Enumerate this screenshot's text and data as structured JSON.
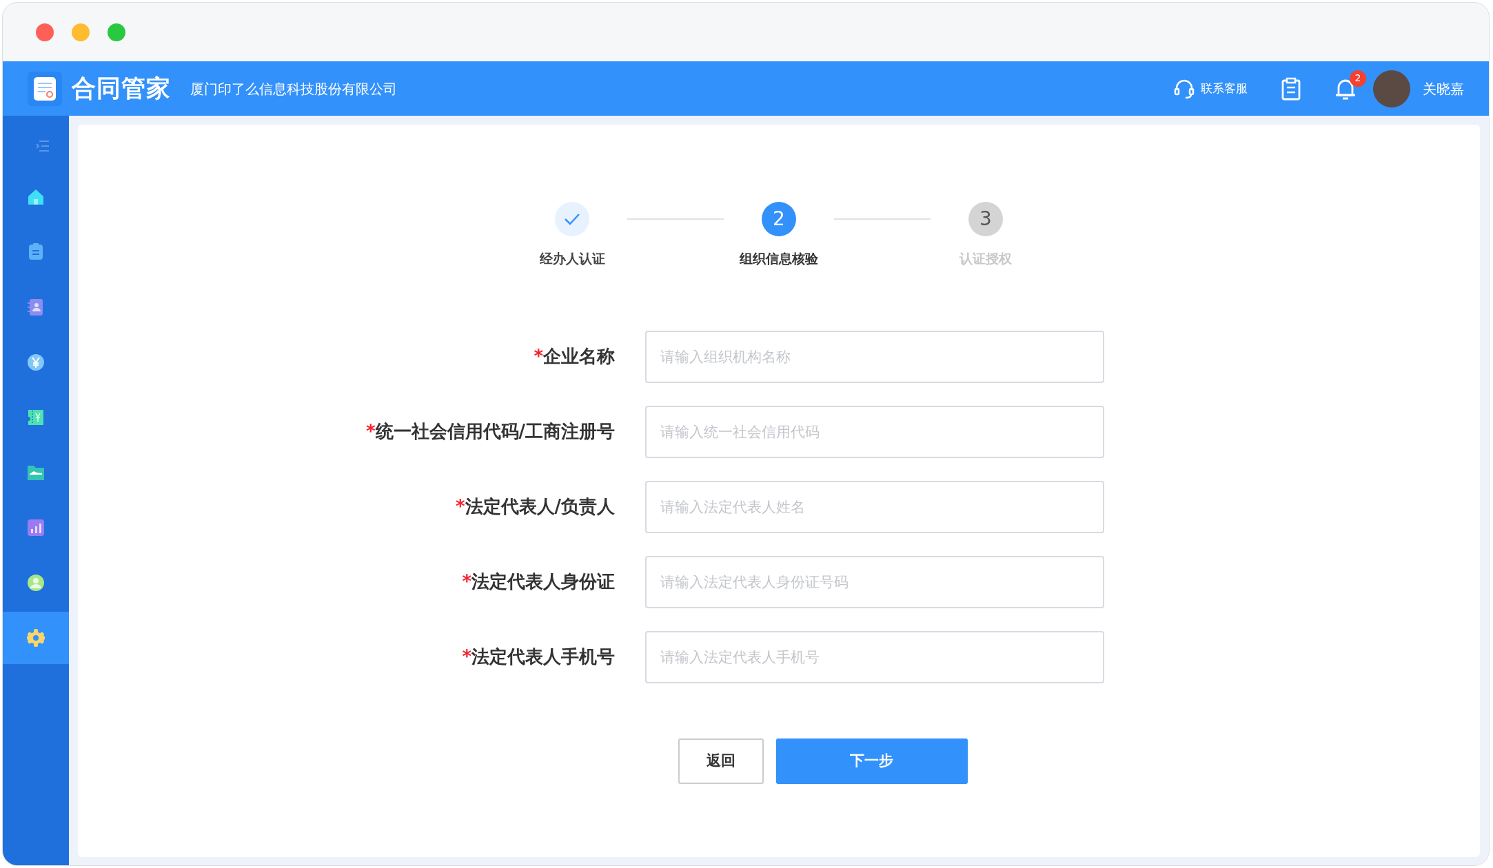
{
  "header": {
    "logo_text": "合同管家",
    "company": "厦门印了么信息科技股份有限公司",
    "support": "联系客服",
    "notification_count": "2",
    "user_name": "关晓嘉"
  },
  "sidebar": {
    "items": [
      {
        "kind": "home",
        "selected": false
      },
      {
        "kind": "document",
        "selected": false
      },
      {
        "kind": "contacts",
        "selected": false
      },
      {
        "kind": "yen",
        "selected": false
      },
      {
        "kind": "ticket",
        "selected": false
      },
      {
        "kind": "folder",
        "selected": false
      },
      {
        "kind": "chart",
        "selected": false
      },
      {
        "kind": "user",
        "selected": false
      },
      {
        "kind": "gear",
        "selected": true
      }
    ]
  },
  "steps": [
    {
      "label": "经办人认证",
      "completed": true,
      "selected": false
    },
    {
      "number": "2",
      "label": "组织信息核验",
      "completed": false,
      "selected": true
    },
    {
      "number": "3",
      "label": "认证授权",
      "completed": false,
      "selected": false
    }
  ],
  "form": {
    "fields": [
      {
        "mark": "*",
        "label": "企业名称",
        "placeholder": "请输入组织机构名称"
      },
      {
        "mark": "*",
        "label": "统一社会信用代码/工商注册号",
        "placeholder": "请输入统一社会信用代码"
      },
      {
        "mark": "*",
        "label": "法定代表人/负责人",
        "placeholder": "请输入法定代表人姓名"
      },
      {
        "mark": "*",
        "label": "法定代表人身份证",
        "placeholder": "请输入法定代表人身份证号码"
      },
      {
        "mark": "*",
        "label": "法定代表人手机号",
        "placeholder": "请输入法定代表人手机号"
      }
    ],
    "buttons": [
      {
        "label": "返回",
        "kind": "secondary"
      },
      {
        "label": "下一步",
        "kind": "primary"
      }
    ]
  }
}
